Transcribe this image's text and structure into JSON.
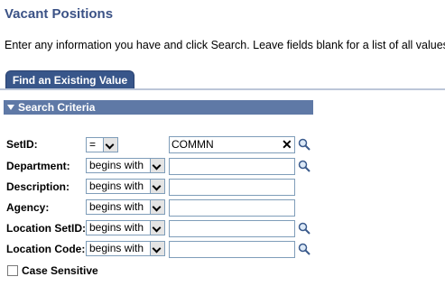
{
  "page": {
    "title": "Vacant Positions",
    "instructions": "Enter any information you have and click Search. Leave fields blank for a list of all values."
  },
  "tab": {
    "label": "Find an Existing Value"
  },
  "section": {
    "label": "Search Criteria"
  },
  "fields": [
    {
      "label": "SetID:",
      "operator": "=",
      "value": "COMMN",
      "has_lookup": true,
      "has_clear": true
    },
    {
      "label": "Department:",
      "operator": "begins with",
      "value": "",
      "has_lookup": true
    },
    {
      "label": "Description:",
      "operator": "begins with",
      "value": "",
      "has_lookup": false
    },
    {
      "label": "Agency:",
      "operator": "begins with",
      "value": "",
      "has_lookup": false
    },
    {
      "label": "Location SetID:",
      "operator": "begins with",
      "value": "",
      "has_lookup": true
    },
    {
      "label": "Location Code:",
      "operator": "begins with",
      "value": "",
      "has_lookup": true
    }
  ],
  "case_sensitive": {
    "label": "Case Sensitive",
    "checked": false
  },
  "colors": {
    "title": "#3b5286",
    "tab": "#38568a",
    "section_bar": "#5f79a6"
  },
  "icons": {
    "lookup": "magnifier-icon",
    "clear": "close-icon"
  }
}
